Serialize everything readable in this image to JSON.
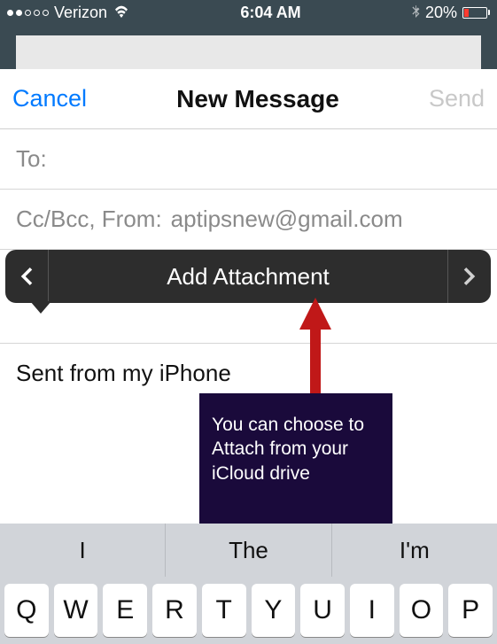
{
  "status": {
    "carrier": "Verizon",
    "time": "6:04 AM",
    "battery_pct": "20%"
  },
  "nav": {
    "cancel": "Cancel",
    "title": "New Message",
    "send": "Send"
  },
  "fields": {
    "to_label": "To:",
    "ccbcc_label": "Cc/Bcc, From:",
    "from_value": "aptipsnew@gmail.com"
  },
  "signature": "Sent from my iPhone",
  "popover": {
    "label": "Add Attachment"
  },
  "annotation": {
    "text": "You can choose to Attach from your iCloud drive"
  },
  "keyboard": {
    "suggestions": [
      "I",
      "The",
      "I'm"
    ],
    "row1": [
      "Q",
      "W",
      "E",
      "R",
      "T",
      "Y",
      "U",
      "I",
      "O",
      "P"
    ]
  }
}
